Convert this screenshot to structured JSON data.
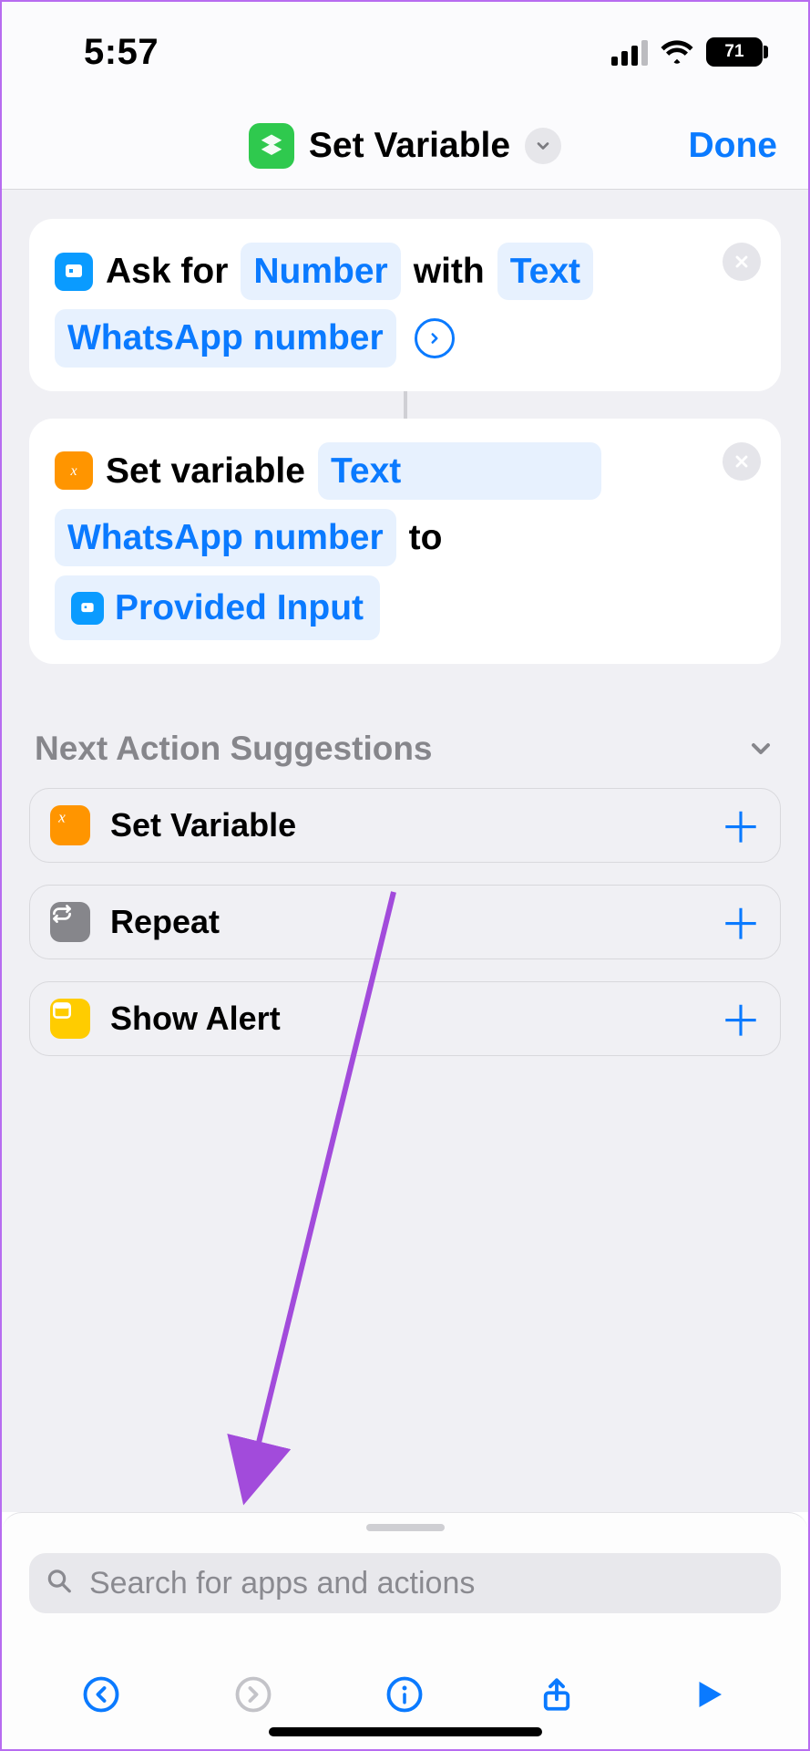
{
  "status": {
    "time": "5:57",
    "battery_pct": "71"
  },
  "nav": {
    "title": "Set Variable",
    "done": "Done"
  },
  "actions": [
    {
      "type": "ask-input",
      "label_prefix": "Ask for",
      "param1": "Number",
      "mid": "with",
      "param2": "Text",
      "prompt_token": "WhatsApp number"
    },
    {
      "type": "set-variable",
      "label_prefix": "Set variable",
      "var_token": "Text",
      "var_name": "WhatsApp number",
      "mid": "to",
      "value_token": "Provided Input"
    }
  ],
  "suggestions": {
    "title": "Next Action Suggestions",
    "items": [
      {
        "label": "Set Variable",
        "icon": "variable"
      },
      {
        "label": "Repeat",
        "icon": "repeat"
      },
      {
        "label": "Show Alert",
        "icon": "alert"
      }
    ]
  },
  "search": {
    "placeholder": "Search for apps and actions"
  }
}
